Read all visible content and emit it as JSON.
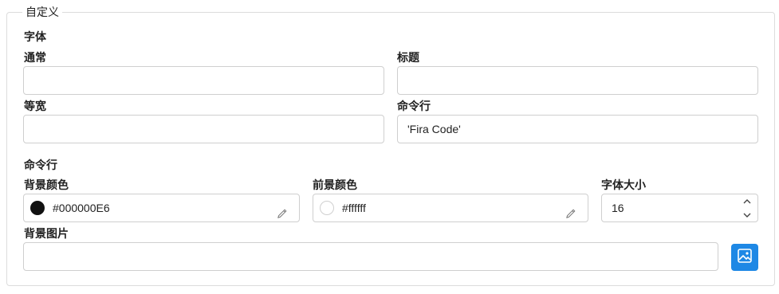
{
  "section_title": "自定义",
  "fonts": {
    "heading": "字体",
    "normal": {
      "label": "通常",
      "value": ""
    },
    "title": {
      "label": "标题",
      "value": ""
    },
    "monospace": {
      "label": "等宽",
      "value": ""
    },
    "terminal": {
      "label": "命令行",
      "value": "'Fira Code'"
    }
  },
  "terminal": {
    "heading": "命令行",
    "background_color": {
      "label": "背景颜色",
      "value": "#000000E6",
      "swatch": "#111111"
    },
    "foreground_color": {
      "label": "前景颜色",
      "value": "#ffffff",
      "swatch": "#ffffff"
    },
    "font_size": {
      "label": "字体大小",
      "value": "16"
    },
    "background_image": {
      "label": "背景图片",
      "value": ""
    }
  },
  "colors": {
    "accent": "#1e88e5",
    "border": "#cfcfcf"
  },
  "icons": [
    "pencil-icon",
    "chevron-up-icon",
    "chevron-down-icon",
    "image-icon"
  ]
}
